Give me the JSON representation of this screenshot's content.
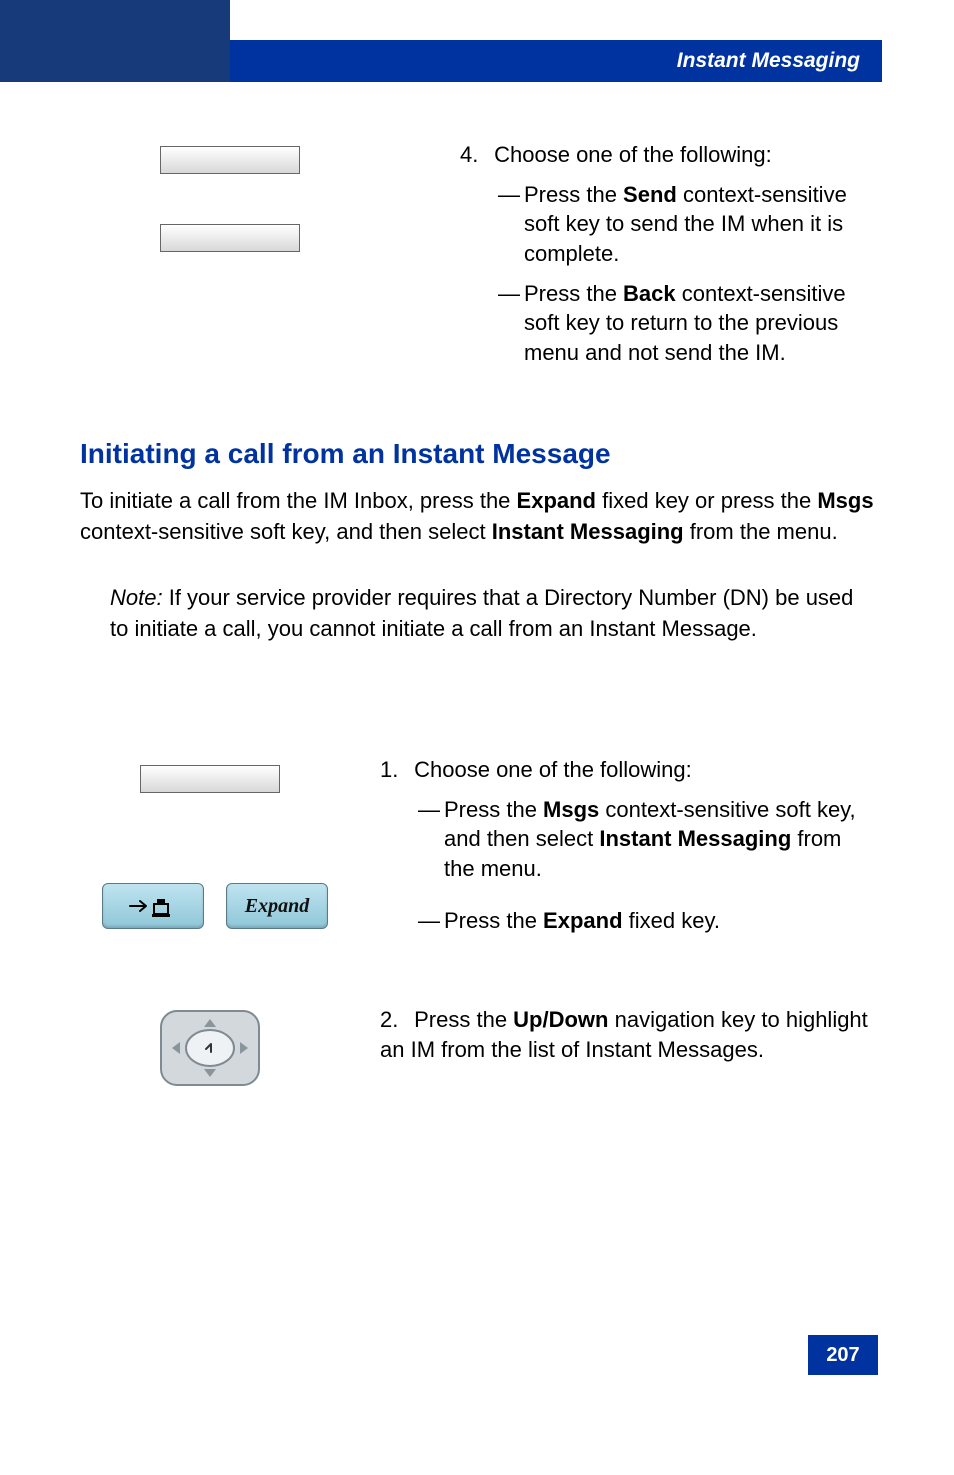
{
  "header": {
    "title": "Instant Messaging"
  },
  "step4": {
    "num": "4.",
    "lead": "Choose one of the following:",
    "sub1_a": "Press the ",
    "sub1_key": "Send",
    "sub1_b": " context-sensitive soft key to send the IM when it is complete.",
    "sub2_a": "Press the ",
    "sub2_key": "Back",
    "sub2_b": " context-sensitive soft key to return to the previous menu and not send the IM."
  },
  "section_heading": "Initiating a call from an Instant Message",
  "intro": {
    "a": "To initiate a call from the IM Inbox, press the ",
    "key1": "Expand",
    "b": " fixed key or press the ",
    "key2": "Msgs",
    "c": " context-sensitive soft key, and then select ",
    "key3": "Instant Messaging",
    "d": " from the menu."
  },
  "note": {
    "label": "Note:",
    "text": " If your service provider requires that a Directory Number (DN) be used to initiate a call, you cannot initiate a call from an Instant Message."
  },
  "step1": {
    "num": "1.",
    "lead": "Choose one of the following:",
    "sub1_a": "Press the ",
    "sub1_key": "Msgs",
    "sub1_b": " context-sensitive soft key, and then select ",
    "sub1_key2": "Instant Messaging",
    "sub1_c": " from the menu.",
    "sub2_a": "Press the ",
    "sub2_key": "Expand",
    "sub2_b": " fixed key."
  },
  "expand_label": "Expand",
  "step2": {
    "num": "2.",
    "a": "Press the ",
    "key": "Up/Down",
    "b": " navigation key to highlight an IM from the list of Instant Messages."
  },
  "page_number": "207"
}
